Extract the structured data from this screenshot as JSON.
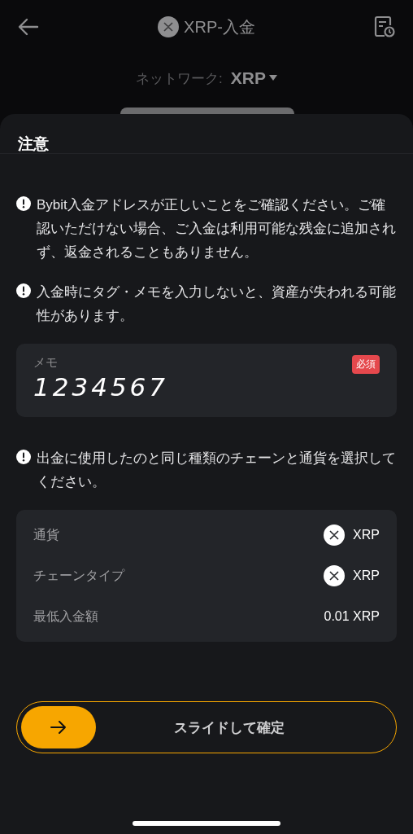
{
  "header": {
    "title": "XRP-入金",
    "network_label": "ネットワーク:",
    "network_value": "XRP"
  },
  "sheet": {
    "title": "注意",
    "notices": [
      {
        "text": "Bybit入金アドレスが正しいことをご確認ください。ご確認いただけない場合、ご入金は利用可能な残金に追加されず、返金されることもありません。"
      },
      {
        "text": "入金時にタグ・メモを入力しないと、資産が失われる可能性があります。"
      },
      {
        "text": "出金に使用したのと同じ種類のチェーンと通貨を選択してください。"
      }
    ],
    "memo": {
      "label": "メモ",
      "badge": "必須",
      "value": "1234567"
    },
    "details": [
      {
        "label": "通貨",
        "value": "XRP",
        "kind": "coin"
      },
      {
        "label": "チェーンタイプ",
        "value": "XRP",
        "kind": "coin"
      },
      {
        "label": "最低入金額",
        "value": "0.01 XRP",
        "kind": "text"
      }
    ],
    "slider": {
      "label": "スライドして確定",
      "level": 0
    }
  }
}
